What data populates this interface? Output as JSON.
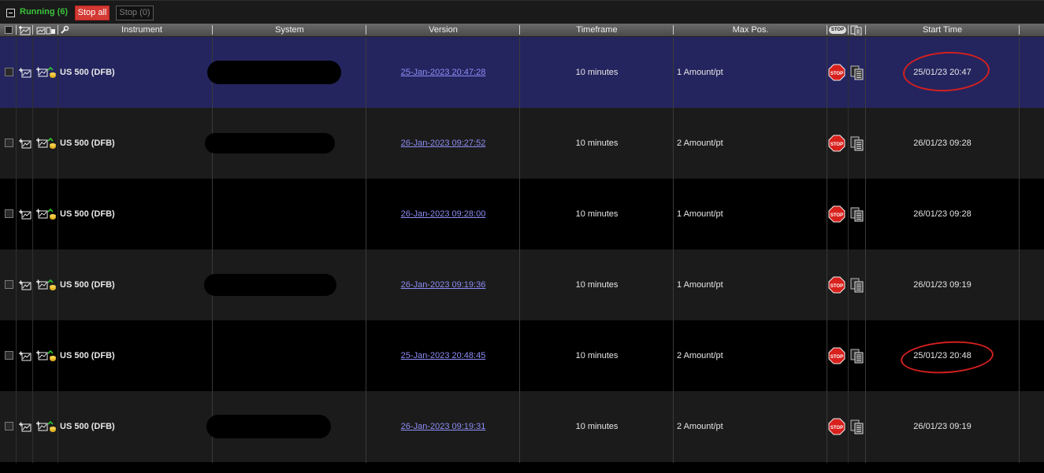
{
  "panel": {
    "running_label": "Running (6)",
    "stop_all_label": "Stop all",
    "stop_label": "Stop (0)"
  },
  "columns": {
    "instrument": "Instrument",
    "system": "System",
    "version": "Version",
    "timeframe": "Timeframe",
    "max_pos": "Max Pos.",
    "stop_badge": "STOP",
    "start_time": "Start Time"
  },
  "icons": {
    "collapse": "minus-square-icon",
    "header_add_chart": "add-chart-icon",
    "header_strategy": "strategy-icon",
    "header_settings": "wrench-icon",
    "row_chart": "chart-icon",
    "row_strategy": "strategy-icon",
    "row_stop": "stop-sign-icon",
    "row_copy": "copy-document-icon"
  },
  "colors": {
    "running": "#39c33c",
    "stop_all_bg": "#d33a33",
    "selected_row": "#24255f",
    "link": "#8d8df5",
    "annotation": "#d41f1f"
  },
  "rows": [
    {
      "instrument": "US 500 (DFB)",
      "version": "25-Jan-2023 20:47:28",
      "timeframe": "10 minutes",
      "max_pos": "1 Amount/pt",
      "start_time": "25/01/23 20:47",
      "stop_label": "STOP"
    },
    {
      "instrument": "US 500 (DFB)",
      "version": "26-Jan-2023 09:27:52",
      "timeframe": "10 minutes",
      "max_pos": "2 Amount/pt",
      "start_time": "26/01/23 09:28",
      "stop_label": "STOP"
    },
    {
      "instrument": "US 500 (DFB)",
      "version": "26-Jan-2023 09:28:00",
      "timeframe": "10 minutes",
      "max_pos": "1 Amount/pt",
      "start_time": "26/01/23 09:28",
      "stop_label": "STOP"
    },
    {
      "instrument": "US 500 (DFB)",
      "version": "26-Jan-2023 09:19:36",
      "timeframe": "10 minutes",
      "max_pos": "1 Amount/pt",
      "start_time": "26/01/23 09:19",
      "stop_label": "STOP"
    },
    {
      "instrument": "US 500 (DFB)",
      "version": "25-Jan-2023 20:48:45",
      "timeframe": "10 minutes",
      "max_pos": "2 Amount/pt",
      "start_time": "25/01/23 20:48",
      "stop_label": "STOP"
    },
    {
      "instrument": "US 500 (DFB)",
      "version": "26-Jan-2023 09:19:31",
      "timeframe": "10 minutes",
      "max_pos": "2 Amount/pt",
      "start_time": "26/01/23 09:19",
      "stop_label": "STOP"
    }
  ]
}
